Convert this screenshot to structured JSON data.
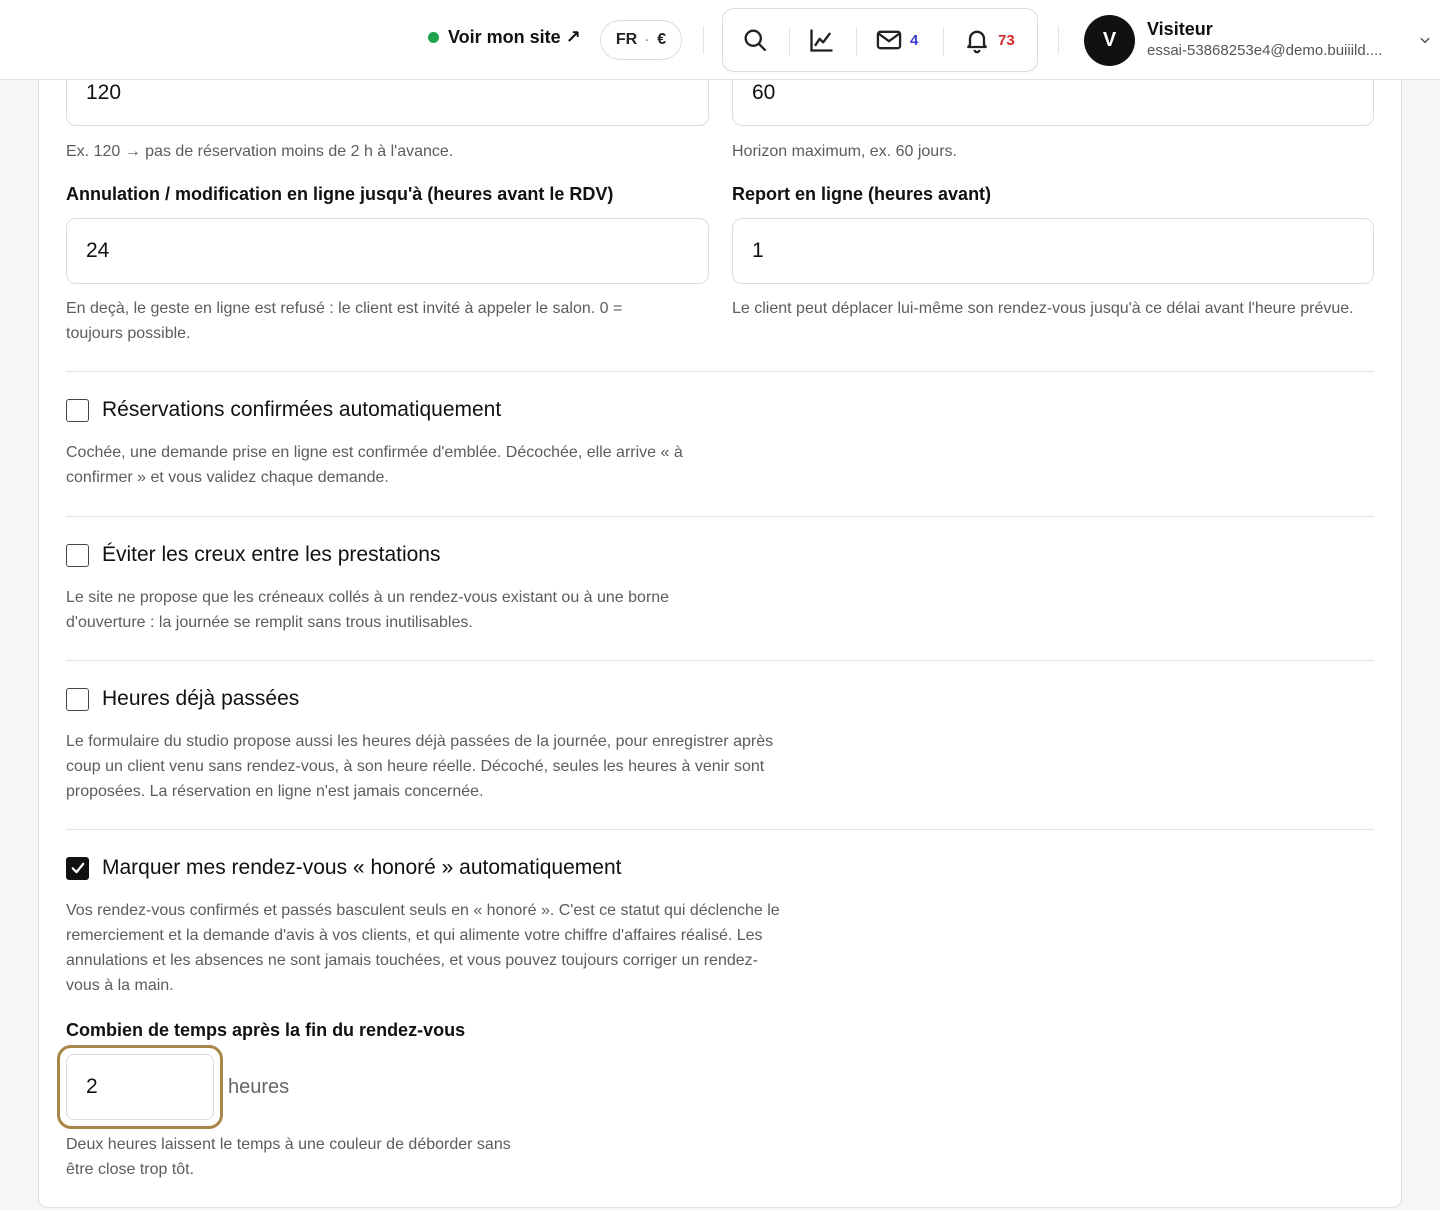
{
  "header": {
    "site_link": "Voir mon site ↗",
    "lang": "FR",
    "currency": "€",
    "messages_count": "4",
    "notifications_count": "73",
    "user_initial": "V",
    "user_name": "Visiteur",
    "user_email": "essai-53868253e4@demo.buiiild...."
  },
  "fields": {
    "min_delay_value": "120",
    "min_delay_hint": "Ex. 120 → pas de réservation moins de 2 h à l'avance.",
    "horizon_value": "60",
    "horizon_hint": "Horizon maximum, ex. 60 jours.",
    "cancel_label": "Annulation / modification en ligne jusqu'à (heures avant le RDV)",
    "cancel_value": "24",
    "cancel_hint": "En deçà, le geste en ligne est refusé : le client est invité à appeler le salon. 0 = toujours possible.",
    "reschedule_label": "Report en ligne (heures avant)",
    "reschedule_value": "1",
    "reschedule_hint": "Le client peut déplacer lui-même son rendez-vous jusqu'à ce délai avant l'heure prévue."
  },
  "options": {
    "auto_confirm_label": "Réservations confirmées automatiquement",
    "auto_confirm_checked": false,
    "auto_confirm_hint": "Cochée, une demande prise en ligne est confirmée d'emblée. Décochée, elle arrive « à confirmer » et vous validez chaque demande.",
    "avoid_gaps_label": "Éviter les creux entre les prestations",
    "avoid_gaps_checked": false,
    "avoid_gaps_hint": "Le site ne propose que les créneaux collés à un rendez-vous existant ou à une borne d'ouverture : la journée se remplit sans trous inutilisables.",
    "past_hours_label": "Heures déjà passées",
    "past_hours_checked": false,
    "past_hours_hint": "Le formulaire du studio propose aussi les heures déjà passées de la journée, pour enregistrer après coup un client venu sans rendez-vous, à son heure réelle. Décoché, seules les heures à venir sont proposées. La réservation en ligne n'est jamais concernée.",
    "auto_honored_label": "Marquer mes rendez-vous « honoré » automatiquement",
    "auto_honored_checked": true,
    "auto_honored_hint": "Vos rendez-vous confirmés et passés basculent seuls en « honoré ». C'est ce statut qui déclenche le remerciement et la demande d'avis à vos clients, et qui alimente votre chiffre d'affaires réalisé. Les annulations et les absences ne sont jamais touchées, et vous pouvez toujours corriger un rendez-vous à la main."
  },
  "delay_after": {
    "label": "Combien de temps après la fin du rendez-vous",
    "value": "2",
    "unit": "heures",
    "hint": "Deux heures laissent le temps à une couleur de déborder sans être close trop tôt."
  },
  "colors": {
    "accent_focus": "#a8864a",
    "online_dot": "#1fa34a",
    "messages_badge": "#3b3bd6",
    "notifications_badge": "#d12b2b"
  }
}
